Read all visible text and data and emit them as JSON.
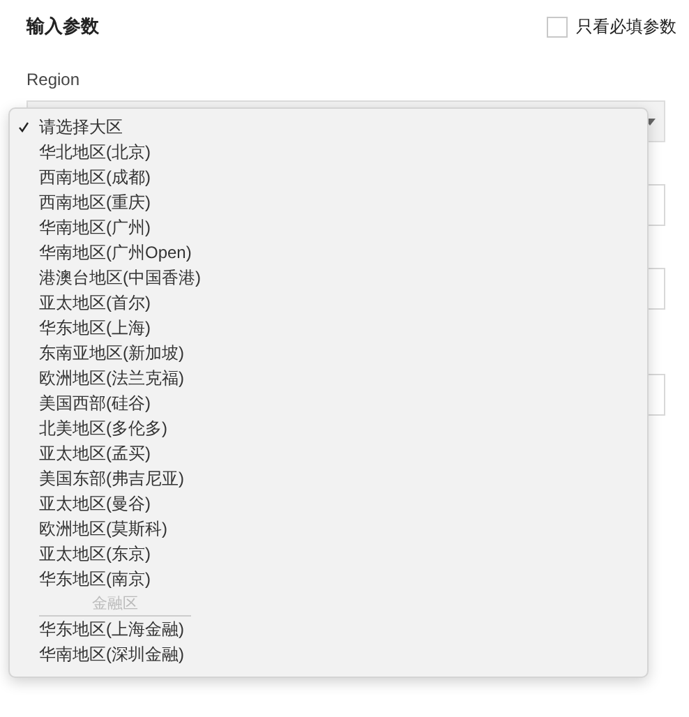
{
  "header": {
    "title": "输入参数",
    "required_only": {
      "label": "只看必填参数",
      "checked": false
    }
  },
  "region": {
    "label": "Region"
  },
  "other_fields": [
    {
      "kind": "text"
    },
    {
      "kind": "text"
    },
    {
      "kind": "text"
    }
  ],
  "dropdown": {
    "items": [
      {
        "kind": "option",
        "label": "请选择大区",
        "selected": true
      },
      {
        "kind": "option",
        "label": "华北地区(北京)",
        "selected": false
      },
      {
        "kind": "option",
        "label": "西南地区(成都)",
        "selected": false
      },
      {
        "kind": "option",
        "label": "西南地区(重庆)",
        "selected": false
      },
      {
        "kind": "option",
        "label": "华南地区(广州)",
        "selected": false
      },
      {
        "kind": "option",
        "label": "华南地区(广州Open)",
        "selected": false
      },
      {
        "kind": "option",
        "label": "港澳台地区(中国香港)",
        "selected": false
      },
      {
        "kind": "option",
        "label": "亚太地区(首尔)",
        "selected": false
      },
      {
        "kind": "option",
        "label": "华东地区(上海)",
        "selected": false
      },
      {
        "kind": "option",
        "label": "东南亚地区(新加坡)",
        "selected": false
      },
      {
        "kind": "option",
        "label": "欧洲地区(法兰克福)",
        "selected": false
      },
      {
        "kind": "option",
        "label": "美国西部(硅谷)",
        "selected": false
      },
      {
        "kind": "option",
        "label": "北美地区(多伦多)",
        "selected": false
      },
      {
        "kind": "option",
        "label": "亚太地区(孟买)",
        "selected": false
      },
      {
        "kind": "option",
        "label": "美国东部(弗吉尼亚)",
        "selected": false
      },
      {
        "kind": "option",
        "label": "亚太地区(曼谷)",
        "selected": false
      },
      {
        "kind": "option",
        "label": "欧洲地区(莫斯科)",
        "selected": false
      },
      {
        "kind": "option",
        "label": "亚太地区(东京)",
        "selected": false
      },
      {
        "kind": "option",
        "label": "华东地区(南京)",
        "selected": false
      },
      {
        "kind": "group",
        "label": "金融区"
      },
      {
        "kind": "option",
        "label": "华东地区(上海金融)",
        "selected": false
      },
      {
        "kind": "option",
        "label": "华南地区(深圳金融)",
        "selected": false
      }
    ]
  }
}
